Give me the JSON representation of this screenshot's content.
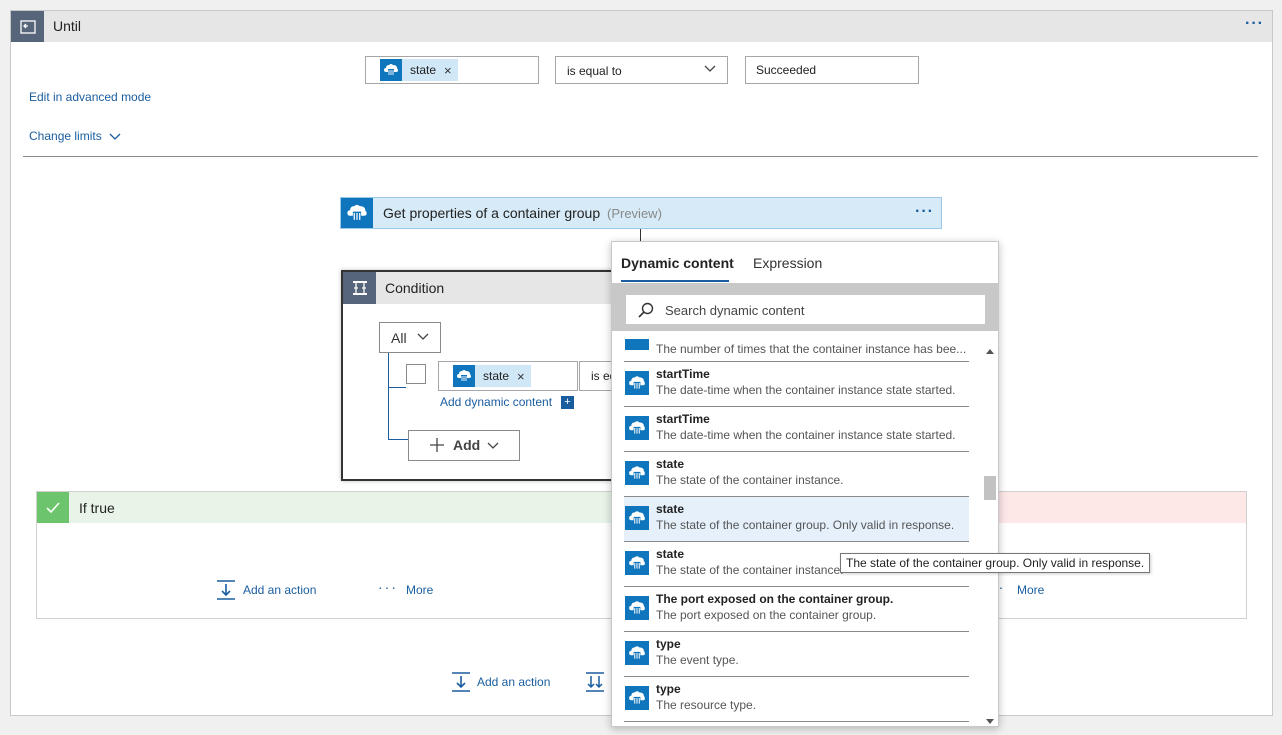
{
  "until": {
    "title": "Until",
    "more_icon": "ellipsis-icon",
    "token_label": "state",
    "operator": "is equal to",
    "value": "Succeeded",
    "edit_advanced": "Edit in advanced mode",
    "change_limits": "Change limits"
  },
  "action": {
    "title": "Get properties of a container group",
    "preview": "(Preview)"
  },
  "condition": {
    "title": "Condition",
    "group_operator": "All",
    "token_label": "state",
    "operator_partial": "is eq",
    "add_dynamic": "Add dynamic content",
    "add_label": "Add"
  },
  "branches": {
    "if_true": "If true",
    "add_action": "Add an action",
    "more": "More"
  },
  "footer": {
    "add_action": "Add an action"
  },
  "dynamic_panel": {
    "tabs": [
      "Dynamic content",
      "Expression"
    ],
    "active_tab": "Dynamic content",
    "search_placeholder": "Search dynamic content",
    "partial_item_desc": "The number of times that the container instance has bee...",
    "items": [
      {
        "name": "startTime",
        "desc": "The date-time when the container instance state started."
      },
      {
        "name": "startTime",
        "desc": "The date-time when the container instance state started."
      },
      {
        "name": "state",
        "desc": "The state of the container instance."
      },
      {
        "name": "state",
        "desc": "The state of the container group. Only valid in response."
      },
      {
        "name": "state",
        "desc": "The state of the container instance."
      },
      {
        "name": "The port exposed on the container group.",
        "desc": "The port exposed on the container group."
      },
      {
        "name": "type",
        "desc": "The event type."
      },
      {
        "name": "type",
        "desc": "The resource type."
      }
    ],
    "tooltip": "The state of the container group. Only valid in response."
  },
  "colors": {
    "accent": "#1a5d9e",
    "azure_blue": "#0f75bc",
    "header_gray": "#57657a",
    "true_green": "#6cc46c",
    "false_red": "#fde7e7"
  }
}
